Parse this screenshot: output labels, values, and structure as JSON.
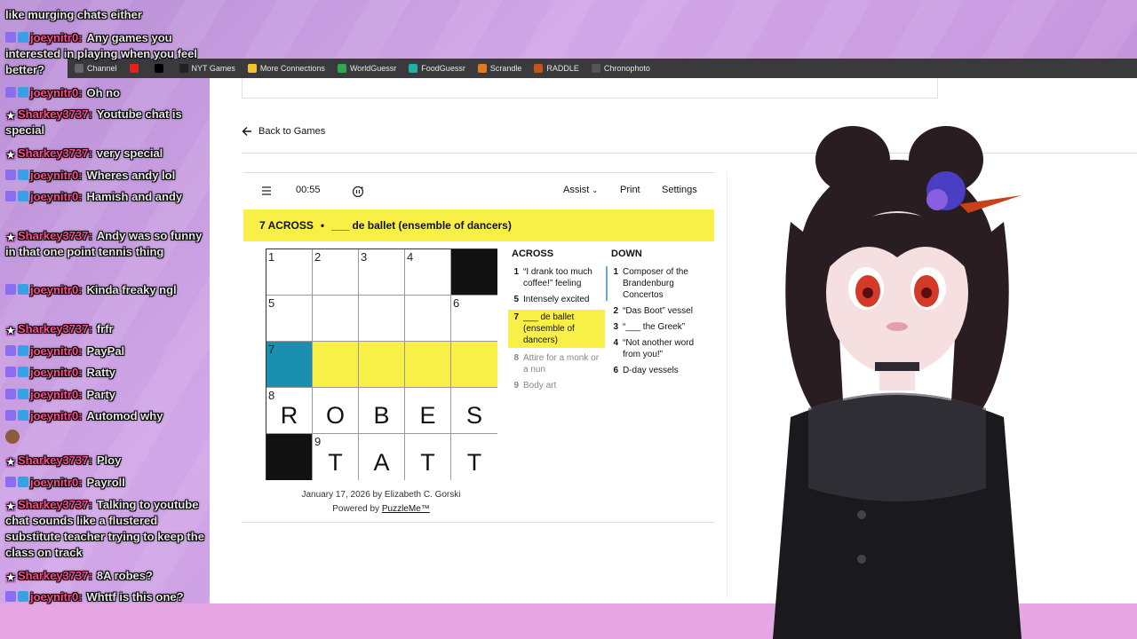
{
  "chat": [
    {
      "user": "",
      "text": "like murging chats either",
      "badges": []
    },
    {
      "user": "joeynitr0:",
      "text": "Any games you interested in playing when you feel better?",
      "badges": [
        "sub",
        "tw"
      ]
    },
    {
      "user": "joeynitr0:",
      "text": "Oh no",
      "badges": [
        "sub",
        "tw"
      ]
    },
    {
      "user": "Sharkey3737:",
      "text": "Youtube chat is special",
      "badges": [
        "star"
      ]
    },
    {
      "user": "Sharkey3737:",
      "text": "very special",
      "badges": [
        "star"
      ]
    },
    {
      "user": "joeynitr0:",
      "text": "Wheres andy lol",
      "badges": [
        "sub",
        "tw"
      ]
    },
    {
      "user": "joeynitr0:",
      "text": "Hamish and andy",
      "badges": [
        "sub",
        "tw"
      ]
    },
    {
      "user": "Sharkey3737:",
      "text": "Andy was so funny in that one point tennis thing",
      "badges": [
        "star"
      ]
    },
    {
      "user": "joeynitr0:",
      "text": "Kinda freaky ngl",
      "badges": [
        "sub",
        "tw"
      ]
    },
    {
      "user": "Sharkey3737:",
      "text": "frfr",
      "badges": [
        "star"
      ]
    },
    {
      "user": "joeynitr0:",
      "text": "PayPal",
      "badges": [
        "sub",
        "tw"
      ]
    },
    {
      "user": "joeynitr0:",
      "text": "Ratty",
      "badges": [
        "sub",
        "tw"
      ]
    },
    {
      "user": "joeynitr0:",
      "text": "Party",
      "badges": [
        "sub",
        "tw"
      ]
    },
    {
      "user": "joeynitr0:",
      "text": "Automod why",
      "badges": [
        "sub",
        "tw"
      ]
    },
    {
      "user": "",
      "text": "",
      "badges": [
        "avatar"
      ]
    },
    {
      "user": "Sharkey3737:",
      "text": "Ploy",
      "badges": [
        "star"
      ]
    },
    {
      "user": "joeynitr0:",
      "text": "Payroll",
      "badges": [
        "sub",
        "tw"
      ]
    },
    {
      "user": "Sharkey3737:",
      "text": "Talking to youtube chat sounds like a flustered substitute teacher trying to keep the class on track",
      "badges": [
        "star"
      ]
    },
    {
      "user": "Sharkey3737:",
      "text": "8A robes?",
      "badges": [
        "star"
      ]
    },
    {
      "user": "joeynitr0:",
      "text": "Whttf is this one?",
      "badges": [
        "sub",
        "tw"
      ]
    }
  ],
  "bookmarks": [
    {
      "label": "Channel",
      "color": "#666666"
    },
    {
      "label": "",
      "color": "#e62117"
    },
    {
      "label": "",
      "color": "#000000",
      "glyph": "X"
    },
    {
      "label": "NYT Games",
      "color": "#222222"
    },
    {
      "label": "More Connections",
      "color": "#f4c430"
    },
    {
      "label": "WorldGuessr",
      "color": "#2fa84f"
    },
    {
      "label": "FoodGuessr",
      "color": "#21b0a5"
    },
    {
      "label": "Scrandle",
      "color": "#e07b1f"
    },
    {
      "label": "RADDLE",
      "color": "#c8541d"
    },
    {
      "label": "Chronophoto",
      "color": "#555555"
    }
  ],
  "page": {
    "back_label": "Back to Games",
    "timer": "00:55",
    "assist": "Assist",
    "print": "Print",
    "settings": "Settings",
    "active_clue_label": "7 ACROSS",
    "active_clue_sep": "•",
    "active_clue_text": "___ de ballet (ensemble of dancers)",
    "footer_line1": "January 17, 2026 by Elizabeth C. Gorski",
    "footer_powered": "Powered by",
    "footer_link": "PuzzleMe™"
  },
  "grid": [
    [
      {
        "n": "1",
        "l": ""
      },
      {
        "n": "2",
        "l": ""
      },
      {
        "n": "3",
        "l": ""
      },
      {
        "n": "4",
        "l": ""
      },
      {
        "b": true
      }
    ],
    [
      {
        "n": "5",
        "l": ""
      },
      {
        "n": "",
        "l": ""
      },
      {
        "n": "",
        "l": ""
      },
      {
        "n": "",
        "l": ""
      },
      {
        "n": "6",
        "l": ""
      }
    ],
    [
      {
        "n": "7",
        "l": "",
        "s": "sel"
      },
      {
        "n": "",
        "l": "",
        "s": "hl"
      },
      {
        "n": "",
        "l": "",
        "s": "hl"
      },
      {
        "n": "",
        "l": "",
        "s": "hl"
      },
      {
        "n": "",
        "l": "",
        "s": "hl"
      }
    ],
    [
      {
        "n": "8",
        "l": "R"
      },
      {
        "n": "",
        "l": "O"
      },
      {
        "n": "",
        "l": "B"
      },
      {
        "n": "",
        "l": "E"
      },
      {
        "n": "",
        "l": "S"
      }
    ],
    [
      {
        "b": true
      },
      {
        "n": "9",
        "l": "T"
      },
      {
        "n": "",
        "l": "A"
      },
      {
        "n": "",
        "l": "T"
      },
      {
        "n": "",
        "l": "T"
      }
    ]
  ],
  "across_title": "ACROSS",
  "across": [
    {
      "n": "1",
      "t": "“I drank too much coffee!” feeling",
      "state": ""
    },
    {
      "n": "5",
      "t": "Intensely excited",
      "state": ""
    },
    {
      "n": "7",
      "t": "___ de ballet (ensemble of dancers)",
      "state": "active"
    },
    {
      "n": "8",
      "t": "Attire for a monk or a nun",
      "state": "dim"
    },
    {
      "n": "9",
      "t": "Body art",
      "state": "dim"
    }
  ],
  "down_title": "DOWN",
  "down": [
    {
      "n": "1",
      "t": "Composer of the Brandenburg Concertos",
      "state": "cross"
    },
    {
      "n": "2",
      "t": "“Das Boot” vessel",
      "state": ""
    },
    {
      "n": "3",
      "t": "“___ the Greek”",
      "state": ""
    },
    {
      "n": "4",
      "t": "“Not another word from you!”",
      "state": ""
    },
    {
      "n": "6",
      "t": "D-day vessels",
      "state": ""
    }
  ],
  "colors": {
    "highlight": "#f8ef47",
    "selected": "#1b8faf",
    "username": "#ff4b8d"
  }
}
